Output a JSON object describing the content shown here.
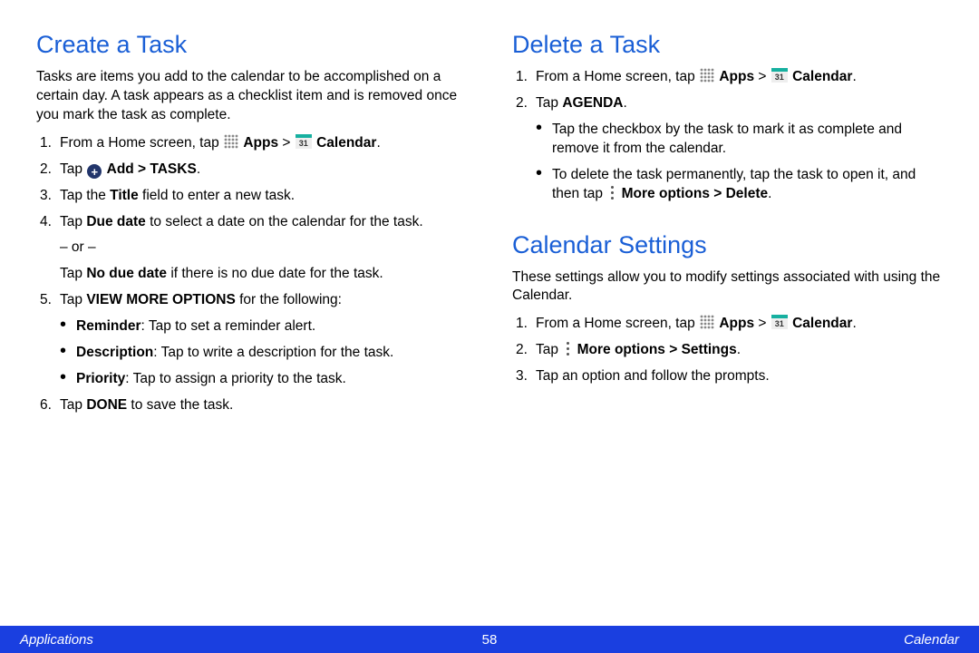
{
  "left": {
    "heading": "Create a Task",
    "intro": "Tasks are items you add to the calendar to be accomplished on a certain day. A task appears as a checklist item and is removed once you mark the task as complete.",
    "step1_a": "From a Home screen, tap ",
    "apps_label": "Apps",
    "sep": " > ",
    "calendar_label": "Calendar",
    "dot": ".",
    "step2_a": "Tap ",
    "add_label": "Add > TASKS",
    "step3_a": "Tap the ",
    "title_bold": "Title",
    "step3_b": " field to enter a new task.",
    "step4_a": "Tap ",
    "due_bold": "Due date",
    "step4_b": " to select a date on the calendar for the task.",
    "or": "– or –",
    "step4_c": "Tap ",
    "nodue_bold": "No due date",
    "step4_d": " if there is no due date for the task.",
    "step5_a": "Tap ",
    "viewmore_bold": "VIEW MORE OPTIONS",
    "step5_b": " for the following:",
    "b1_label": "Reminder",
    "b1_text": ": Tap to set a reminder alert.",
    "b2_label": "Description",
    "b2_text": ": Tap to write a description for the task.",
    "b3_label": "Priority",
    "b3_text": ": Tap to assign a priority to the task.",
    "step6_a": "Tap ",
    "done_bold": "DONE",
    "step6_b": " to save the task."
  },
  "right": {
    "heading1": "Delete a Task",
    "d1_a": "From a Home screen, tap ",
    "apps_label": "Apps",
    "sep": " > ",
    "calendar_label": "Calendar",
    "dot": ".",
    "d2_a": "Tap ",
    "agenda_bold": "AGENDA",
    "db1": "Tap the checkbox by the task to mark it as complete and remove it from the calendar.",
    "db2_a": "To delete the task permanently, tap the task to open it, and then tap ",
    "more_label": "More options > Delete",
    "heading2": "Calendar Settings",
    "c_intro": "These settings allow you to modify settings associated with using the Calendar.",
    "c1_a": "From a Home screen, tap ",
    "c2_a": "Tap ",
    "c2_bold": "More options > Settings",
    "c3": "Tap an option and follow the prompts."
  },
  "footer": {
    "left": "Applications",
    "center": "58",
    "right": "Calendar"
  },
  "icons": {
    "cal_num": "31"
  }
}
